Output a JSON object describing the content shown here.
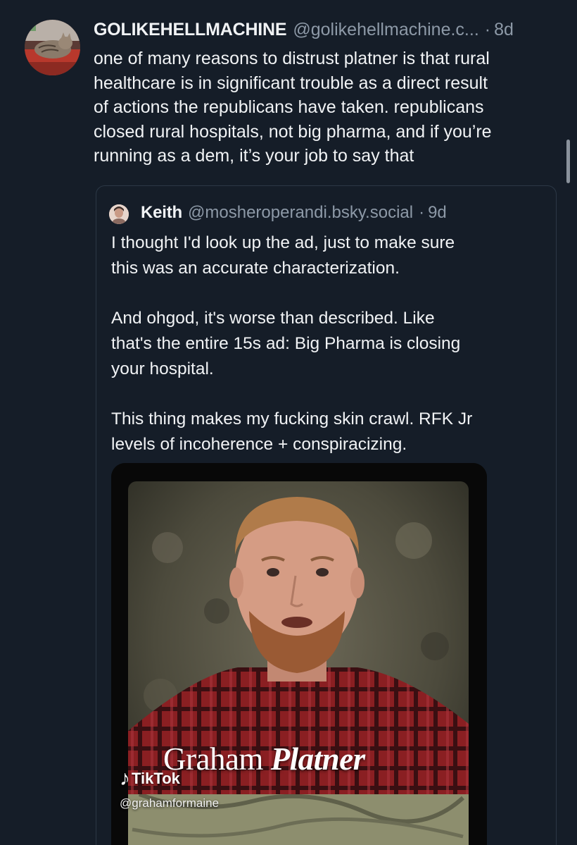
{
  "post": {
    "author": {
      "display_name": "GOLIKEHELLMACHINE",
      "handle": "@golikehellmachine.c...",
      "avatar_icon": "cat-avatar"
    },
    "separator": "·",
    "time": "8d",
    "text": "one of many reasons to distrust platner is that rural\nhealthcare is in significant trouble as a direct result\nof actions the republicans have taken. republicans\nclosed rural hospitals, not big pharma, and if you’re\nrunning as a dem, it’s your job to say that"
  },
  "quote": {
    "author": {
      "display_name": "Keith",
      "handle": "@mosheroperandi.bsky.social",
      "avatar_icon": "person-avatar"
    },
    "separator": "·",
    "time": "9d",
    "text": "I thought I'd look up the ad, just to make sure\nthis was an accurate characterization.\n\nAnd ohgod, it's worse than described. Like\nthat's the entire 15s ad: Big Pharma is closing\nyour hospital.\n\nThis thing makes my fucking skin crawl. RFK Jr\nlevels of incoherence + conspiracizing.",
    "video": {
      "title_regular": "Graham",
      "title_strong": "Platner",
      "watermark": "TikTok",
      "watermark_icon": "tiktok-note-icon",
      "creator_handle": "@grahamformaine"
    }
  },
  "colors": {
    "background": "#151d28",
    "text_primary": "#f1f3f5",
    "text_secondary": "#8d99a7",
    "border": "#2c3846"
  }
}
